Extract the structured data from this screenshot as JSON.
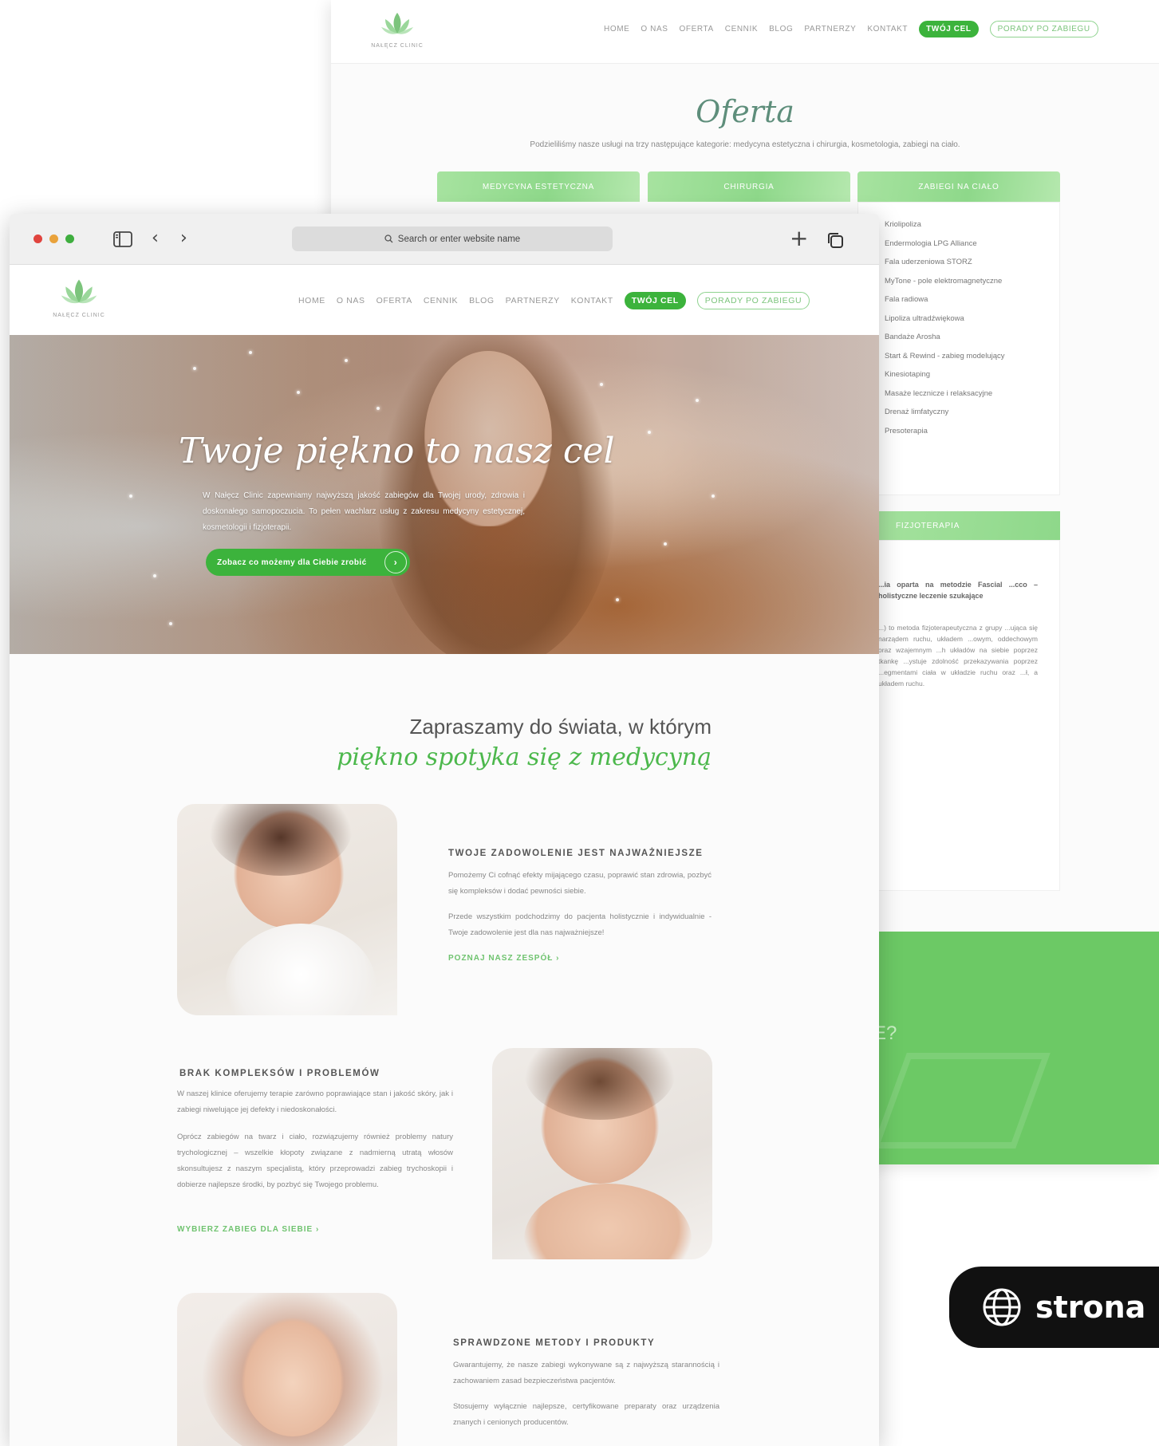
{
  "background_page": {
    "logo_text": "NAŁĘCZ CLINIC",
    "nav": [
      "HOME",
      "O NAS",
      "OFERTA",
      "CENNIK",
      "BLOG",
      "PARTNERZY",
      "KONTAKT"
    ],
    "nav_cta_primary": "TWÓJ CEL",
    "nav_cta_secondary": "PORADY PO ZABIEGU",
    "title": "Oferta",
    "subtitle": "Podzieliliśmy nasze usługi na trzy następujące kategorie: medycyna estetyczna i chirurgia, kosmetologia, zabiegi na ciało.",
    "tabs": [
      "MEDYCYNA ESTETYCZNA",
      "CHIRURGIA",
      "ZABIEGI NA CIAŁO"
    ],
    "body_treatments": [
      "Kriolipoliza",
      "Endermologia LPG Alliance",
      "Fala uderzeniowa STORZ",
      "MyTone - pole elektromagnetyczne",
      "Fala radiowa",
      "Lipoliza ultradźwiękowa",
      "Bandaże Arosha",
      "Start & Rewind - zabieg modelujący",
      "Kinesiotaping",
      "Masaże lecznicze i relaksacyjne",
      "Drenaż limfatyczny",
      "Presoterapia"
    ],
    "fizjo_tab": "FIZJOTERAPIA",
    "fizjo_bold": "...ia oparta na metodzie Fascial ...cco – holistyczne leczenie szukające",
    "fizjo_text": "...) to metoda fizjoterapeutyczna z grupy ...ująca się narządem ruchu, układem ...owym, oddechowym oraz wzajemnym ...h układów na siebie poprzez tkankę ...ystuje zdolność przekazywania poprzez ...egmentami ciała w układzie ruchu oraz ...ł, a układem ruchu.",
    "green_question": "E?"
  },
  "browser": {
    "address_placeholder": "Search or enter website name",
    "logo_text": "NAŁĘCZ CLINIC",
    "nav": [
      "HOME",
      "O NAS",
      "OFERTA",
      "CENNIK",
      "BLOG",
      "PARTNERZY",
      "KONTAKT"
    ],
    "nav_cta_primary": "TWÓJ CEL",
    "nav_cta_secondary": "PORADY PO ZABIEGU",
    "hero": {
      "title": "Twoje piękno to nasz cel",
      "text": "W Nałęcz Clinic zapewniamy najwyższą jakość zabiegów dla Twojej urody, zdrowia i doskonałego samopoczucia. To pełen wachlarz usług z zakresu medycyny estetycznej, kosmetologii i fizjoterapii.",
      "button": "Zobacz co możemy dla Ciebie zrobić"
    },
    "invite_line1": "Zapraszamy do świata, w którym",
    "invite_line2": "piękno spotyka się z medycyną",
    "sections": [
      {
        "heading": "TWOJE ZADOWOLENIE JEST NAJWAŻNIEJSZE",
        "p1": "Pomożemy Ci cofnąć efekty mijającego czasu, poprawić stan zdrowia, pozbyć się kompleksów i dodać pewności siebie.",
        "p2": "Przede wszystkim podchodzimy do pacjenta holistycznie i indywidualnie - Twoje zadowolenie jest dla nas najważniejsze!",
        "link": "POZNAJ NASZ ZESPÓŁ"
      },
      {
        "heading": "BRAK KOMPLEKSÓW I PROBLEMÓW",
        "p1": "W naszej klinice oferujemy terapie zarówno poprawiające stan i jakość skóry, jak i zabiegi niwelujące jej defekty i niedoskonałości.",
        "p2": "Oprócz zabiegów na twarz i ciało, rozwiązujemy również problemy natury trychologicznej – wszelkie kłopoty związane z nadmierną utratą włosów skonsultujesz z naszym specjalistą, który przeprowadzi zabieg trychoskopii i dobierze najlepsze środki, by pozbyć się Twojego problemu.",
        "link": "WYBIERZ ZABIEG DLA SIEBIE"
      },
      {
        "heading": "SPRAWDZONE METODY I PRODUKTY",
        "p1": "Gwarantujemy, że nasze zabiegi wykonywane są z najwyższą starannością i zachowaniem zasad bezpieczeństwa pacjentów.",
        "p2": "Stosujemy wyłącznie najlepsze, certyfikowane preparaty oraz urządzenia znanych i cenionych producentów."
      }
    ]
  },
  "badge": {
    "label": "strona"
  },
  "colors": {
    "accent": "#3cb33c",
    "accent_light": "#8ed88a",
    "band": "#6cc965"
  }
}
